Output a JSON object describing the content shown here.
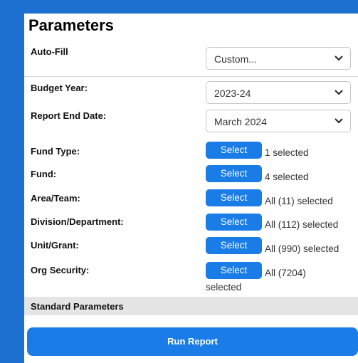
{
  "panel": {
    "title": "Parameters"
  },
  "auto_fill": {
    "label": "Auto-Fill",
    "value": "Custom..."
  },
  "budget_year": {
    "label": "Budget Year:",
    "value": "2023-24"
  },
  "report_end_date": {
    "label": "Report End Date:",
    "value": "March 2024"
  },
  "select_rows": [
    {
      "label": "Fund Type:",
      "button": "Select",
      "count": "1 selected"
    },
    {
      "label": "Fund:",
      "button": "Select",
      "count": "4 selected"
    },
    {
      "label": "Area/Team:",
      "button": "Select",
      "count": "All (11) selected"
    },
    {
      "label": "Division/Department:",
      "button": "Select",
      "count": "All (112) selected"
    },
    {
      "label": "Unit/Grant:",
      "button": "Select",
      "count": "All (990) selected"
    },
    {
      "label": "Org Security:",
      "button": "Select",
      "count": "All (7204)",
      "count_wrap": "selected"
    }
  ],
  "standard_parameters": {
    "label": "Standard Parameters"
  },
  "run_button": {
    "label": "Run Report"
  },
  "colors": {
    "frame_blue": "#1d6fd0",
    "button_blue": "#1a7ce6",
    "section_gray": "#e5e5e5"
  },
  "icons": {
    "dropdown": "chevron-down-icon"
  }
}
